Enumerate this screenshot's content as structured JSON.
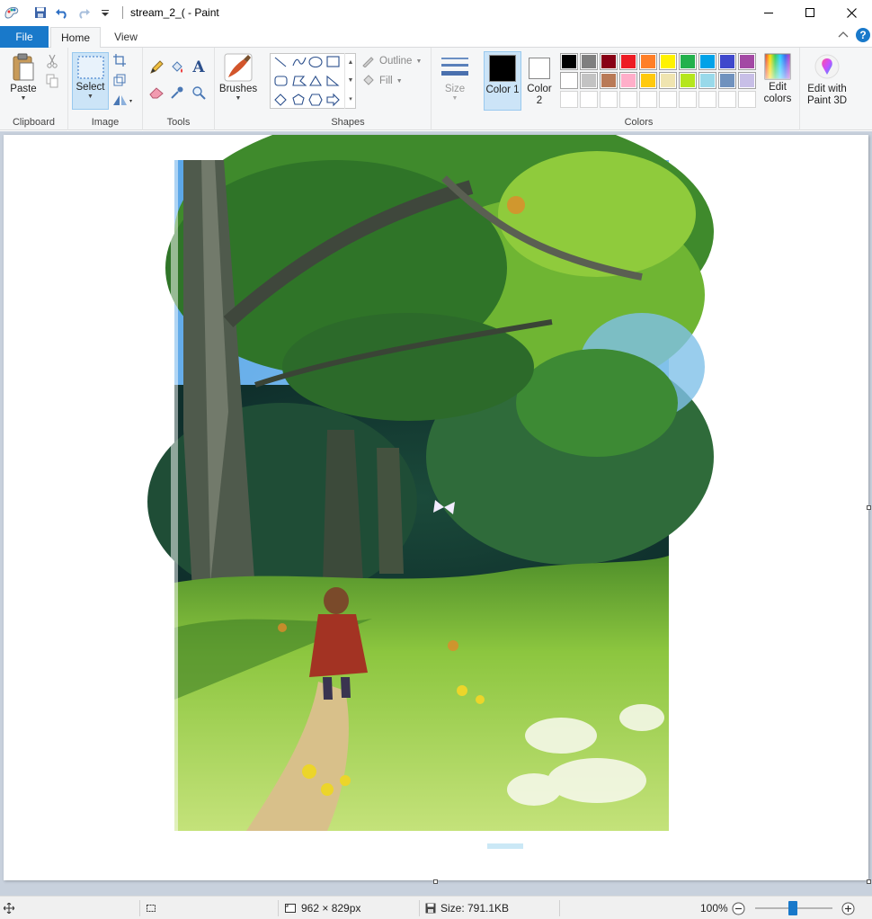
{
  "window": {
    "title": "stream_2_( - Paint"
  },
  "tabs": {
    "file": "File",
    "home": "Home",
    "view": "View"
  },
  "clipboard": {
    "paste_label": "Paste",
    "group_label": "Clipboard"
  },
  "image": {
    "select_label": "Select",
    "group_label": "Image"
  },
  "tools": {
    "group_label": "Tools"
  },
  "brushes": {
    "label": "Brushes"
  },
  "shapes": {
    "outline_label": "Outline",
    "fill_label": "Fill",
    "group_label": "Shapes"
  },
  "size": {
    "label": "Size"
  },
  "colors": {
    "color1_label": "Color 1",
    "color2_label": "Color 2",
    "edit_colors_label": "Edit colors",
    "group_label": "Colors",
    "color1_value": "#000000",
    "color2_value": "#ffffff",
    "palette": [
      "#000000",
      "#7f7f7f",
      "#880015",
      "#ed1c24",
      "#ff7f27",
      "#fff200",
      "#22b14c",
      "#00a2e8",
      "#3f48cc",
      "#a349a4",
      "#ffffff",
      "#c3c3c3",
      "#b97a57",
      "#ffaec9",
      "#ffc90e",
      "#efe4b0",
      "#b5e61d",
      "#99d9ea",
      "#7092be",
      "#c8bfe7",
      "",
      "",
      "",
      "",
      "",
      "",
      "",
      "",
      "",
      ""
    ]
  },
  "paint3d": {
    "label": "Edit with Paint 3D"
  },
  "status": {
    "dimensions": "962 × 829px",
    "size": "Size: 791.1KB",
    "zoom": "100%"
  }
}
